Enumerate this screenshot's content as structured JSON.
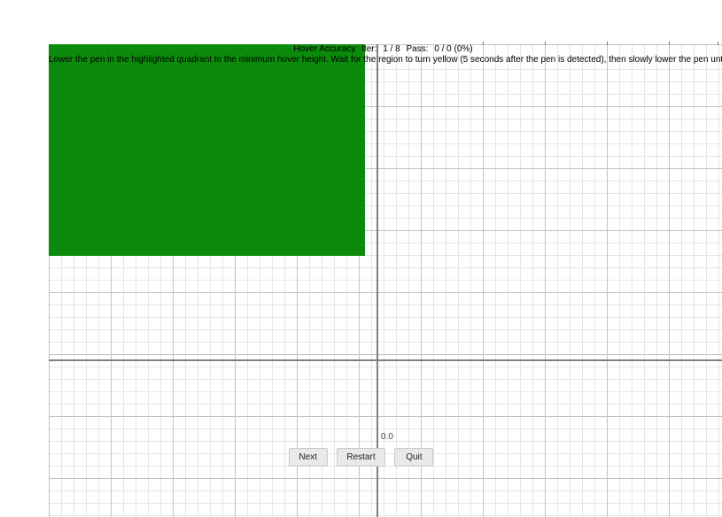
{
  "header": {
    "title_label": "Hover Accuracy",
    "iter_label": "Iter:",
    "iter_value": "1 / 8",
    "pass_label": "Pass:",
    "pass_value": "0 / 0 (0%)",
    "instructions": "Lower the pen in the highlighted quadrant to the minimum hover height. Wait for the region to turn yellow (5 seconds after the pen is detected), then slowly lower the pen until it hits the screen. When the region turns green again, lift the pen."
  },
  "center_value": "0.0",
  "buttons": {
    "next": "Next",
    "restart": "Restart",
    "quit": "Quit"
  },
  "quadrant": {
    "state": "green",
    "color": "#0b8a0b"
  }
}
